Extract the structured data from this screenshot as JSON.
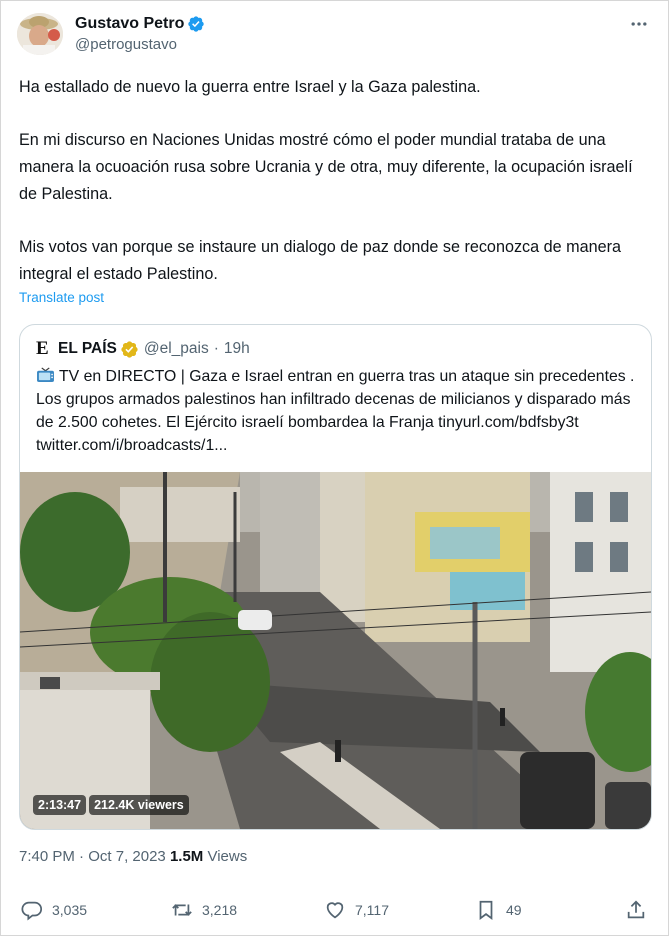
{
  "author": {
    "name": "Gustavo Petro",
    "handle": "@petrogustavo"
  },
  "post": {
    "paragraphs": [
      "Ha estallado de nuevo la guerra entre Israel y la Gaza palestina.",
      "En mi discurso en Naciones Unidas mostré cómo el poder mundial trataba de una manera la ocuoación rusa sobre Ucrania y de otra, muy diferente, la ocupación israelí de Palestina.",
      "Mis votos van porque se instaure un dialogo de paz donde se reconozca de manera integral el estado Palestino."
    ],
    "translate_label": "Translate post"
  },
  "quote": {
    "logo": "E",
    "name": "EL PAÍS",
    "handle": "@el_pais",
    "separator": "·",
    "time": "19h",
    "text": "TV en DIRECTO | Gaza e Israel entran en guerra tras un ataque sin precedentes . Los grupos armados palestinos han infiltrado decenas de milicianos y disparado más de 2.500 cohetes. El Ejército israelí bombardea la Franja tinyurl.com/bdfsby3t twitter.com/i/broadcasts/1...",
    "media": {
      "duration": "2:13:47",
      "viewers": "212.4K viewers"
    }
  },
  "meta": {
    "time": "7:40 PM",
    "separator": "·",
    "date": "Oct 7, 2023",
    "views_count": "1.5M",
    "views_label": "Views"
  },
  "actions": {
    "replies": "3,035",
    "reposts": "3,218",
    "likes": "7,117",
    "bookmarks": "49"
  },
  "icons": {
    "verified": "verified-badge-icon",
    "gold_verified": "gold-verified-badge-icon",
    "more": "more-icon",
    "reply": "reply-icon",
    "repost": "repost-icon",
    "like": "heart-icon",
    "bookmark": "bookmark-icon",
    "share": "share-icon",
    "tv": "tv-icon"
  },
  "colors": {
    "link": "#1d9bf0",
    "secondary_text": "#536471",
    "verified_blue": "#1d9bf0",
    "verified_gold": "#e2b719"
  }
}
